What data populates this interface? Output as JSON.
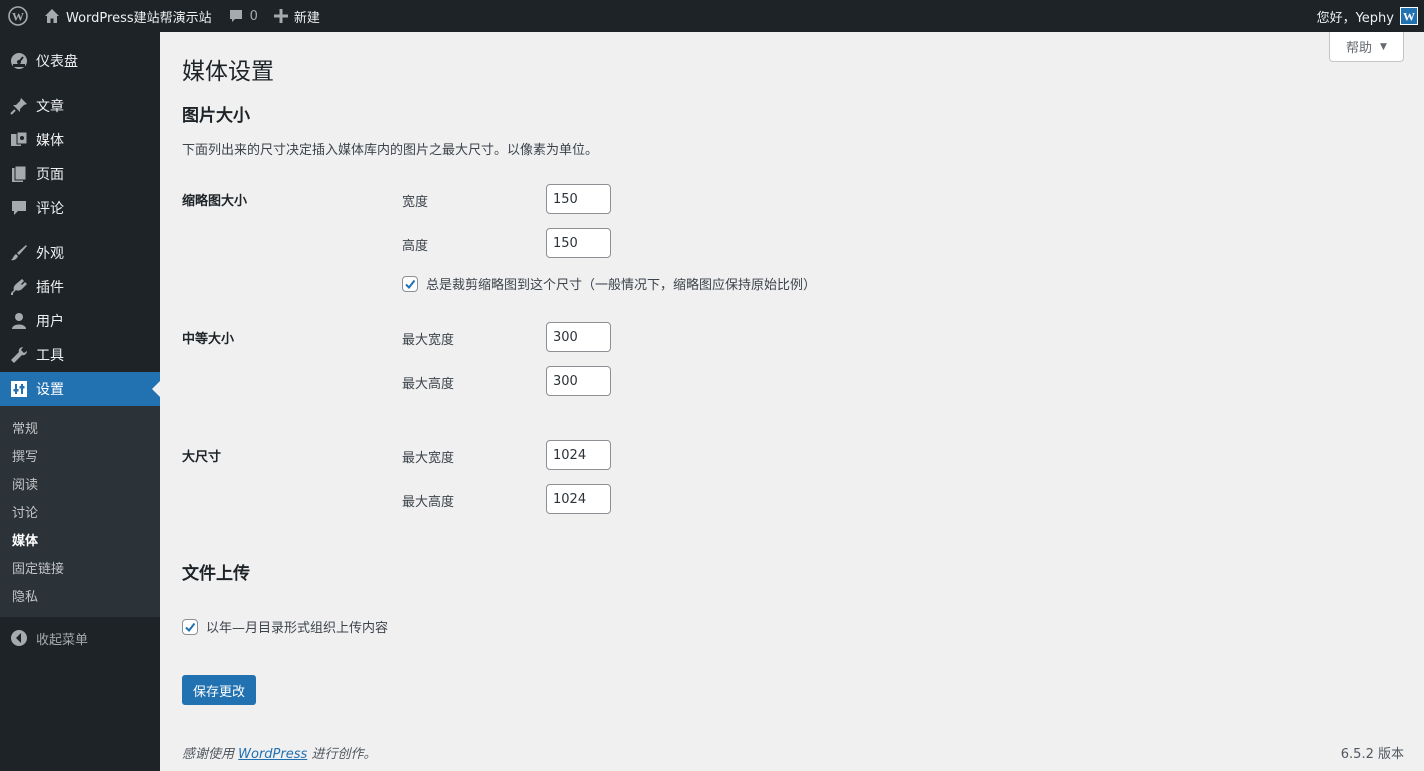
{
  "adminbar": {
    "site_name": "WordPress建站帮演示站",
    "comments_count": "0",
    "new_label": "新建",
    "greeting": "您好，Yephy"
  },
  "sidebar": {
    "items": [
      {
        "label": "仪表盘",
        "icon": "dashboard-icon"
      },
      {
        "label": "文章",
        "icon": "pushpin-icon"
      },
      {
        "label": "媒体",
        "icon": "media-icon"
      },
      {
        "label": "页面",
        "icon": "page-icon"
      },
      {
        "label": "评论",
        "icon": "comment-icon"
      },
      {
        "label": "外观",
        "icon": "paintbrush-icon"
      },
      {
        "label": "插件",
        "icon": "plugin-icon"
      },
      {
        "label": "用户",
        "icon": "user-icon"
      },
      {
        "label": "工具",
        "icon": "wrench-icon"
      },
      {
        "label": "设置",
        "icon": "settings-icon"
      }
    ],
    "submenu": [
      "常规",
      "撰写",
      "阅读",
      "讨论",
      "媒体",
      "固定链接",
      "隐私"
    ],
    "collapse_label": "收起菜单"
  },
  "help_label": "帮助",
  "page_title": "媒体设置",
  "images": {
    "title": "图片大小",
    "description": "下面列出来的尺寸决定插入媒体库内的图片之最大尺寸。以像素为单位。",
    "thumbnail": {
      "label": "缩略图大小",
      "width_label": "宽度",
      "width_value": "150",
      "height_label": "高度",
      "height_value": "150",
      "crop_label": "总是裁剪缩略图到这个尺寸（一般情况下，缩略图应保持原始比例）",
      "crop_checked": true
    },
    "medium": {
      "label": "中等大小",
      "width_label": "最大宽度",
      "width_value": "300",
      "height_label": "最大高度",
      "height_value": "300"
    },
    "large": {
      "label": "大尺寸",
      "width_label": "最大宽度",
      "width_value": "1024",
      "height_label": "最大高度",
      "height_value": "1024"
    }
  },
  "uploads": {
    "title": "文件上传",
    "organize_label": "以年—月目录形式组织上传内容",
    "organize_checked": true
  },
  "save_label": "保存更改",
  "footer": {
    "thanks_prefix": "感谢使用",
    "thanks_link": "WordPress",
    "thanks_suffix": "进行创作。",
    "version": "6.5.2 版本"
  },
  "colors": {
    "adminbar_bg": "#1d2327",
    "accent": "#2271b1",
    "page_bg": "#f0f0f1"
  }
}
